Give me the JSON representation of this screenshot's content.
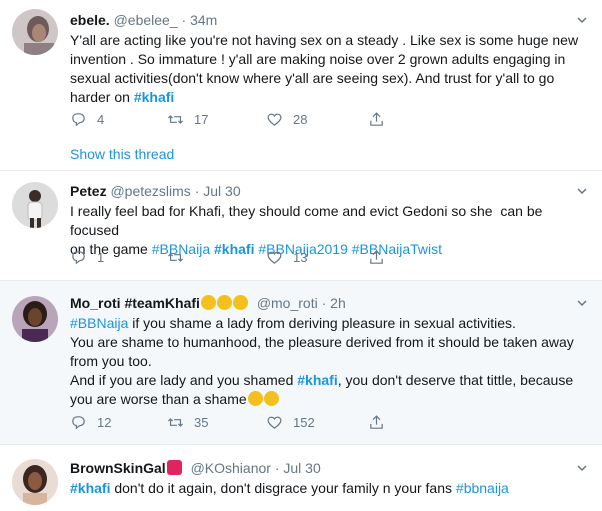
{
  "tweets": [
    {
      "name": "ebele.",
      "handle": "@ebelee_",
      "sep": "·",
      "time": "34m",
      "lines": [
        [
          {
            "t": "Y'all are acting like you're not having sex on a steady . Like sex is some huge new"
          }
        ],
        [
          {
            "t": "invention . So immature ! y'all are making noise over 2 grown adults engaging in"
          }
        ],
        [
          {
            "t": "sexual activities(don't know where y'all are seeing sex). And trust for y'all to go"
          }
        ],
        [
          {
            "t": "harder on "
          },
          {
            "t": "#khafi",
            "tag": true,
            "bold": true
          }
        ]
      ],
      "replies": "4",
      "retweets": "17",
      "likes": "28",
      "show_thread": "Show this thread"
    },
    {
      "name": "Petez",
      "handle": "@petezslims",
      "sep": "·",
      "time": "Jul 30",
      "lines": [
        [
          {
            "t": "I really feel bad for Khafi, they should come and evict Gedoni so she  can be focused"
          }
        ],
        [
          {
            "t": "on the game "
          },
          {
            "t": "#BBNaija",
            "tag": true
          },
          {
            "t": " "
          },
          {
            "t": "#khafi",
            "tag": true,
            "bold": true
          },
          {
            "t": " "
          },
          {
            "t": "#BBNaija2019",
            "tag": true
          },
          {
            "t": " "
          },
          {
            "t": "#BBNaijaTwist",
            "tag": true
          }
        ]
      ],
      "replies": "1",
      "retweets": "",
      "likes": "13"
    },
    {
      "name": "Mo_roti #teamKhafi",
      "handle": "@mo_roti",
      "sep": "·",
      "time": "2h",
      "lines": [
        [
          {
            "t": "#BBNaija",
            "tag": true
          },
          {
            "t": " if you shame a lady from deriving pleasure in sexual activities."
          }
        ],
        [
          {
            "t": "You are shame to humanhood, the pleasure derived from it should be taken away"
          }
        ],
        [
          {
            "t": "from you too."
          }
        ],
        [
          {
            "t": "And if you are lady and you shamed "
          },
          {
            "t": "#khafi",
            "tag": true,
            "bold": true
          },
          {
            "t": ", you don't deserve that tittle, because"
          }
        ],
        [
          {
            "t": "you are worse than a shame"
          }
        ]
      ],
      "replies": "12",
      "retweets": "35",
      "likes": "152"
    },
    {
      "name": "BrownSkinGal",
      "handle": "@KOshianor",
      "sep": "·",
      "time": "Jul 30",
      "lines": [
        [
          {
            "t": "#khafi",
            "tag": true,
            "bold": true
          },
          {
            "t": " don't do it again, don't disgrace your family n your fans "
          },
          {
            "t": "#bbnaija",
            "tag": true
          }
        ]
      ]
    }
  ],
  "colors": {
    "accent": "#1b95e0",
    "muted": "#657786",
    "text": "#14171a",
    "highlight_bg": "#f5f8fa",
    "divider": "#e6ecf0"
  },
  "icons": [
    "reply-icon",
    "retweet-icon",
    "like-icon",
    "share-icon",
    "chevron-down-icon"
  ]
}
